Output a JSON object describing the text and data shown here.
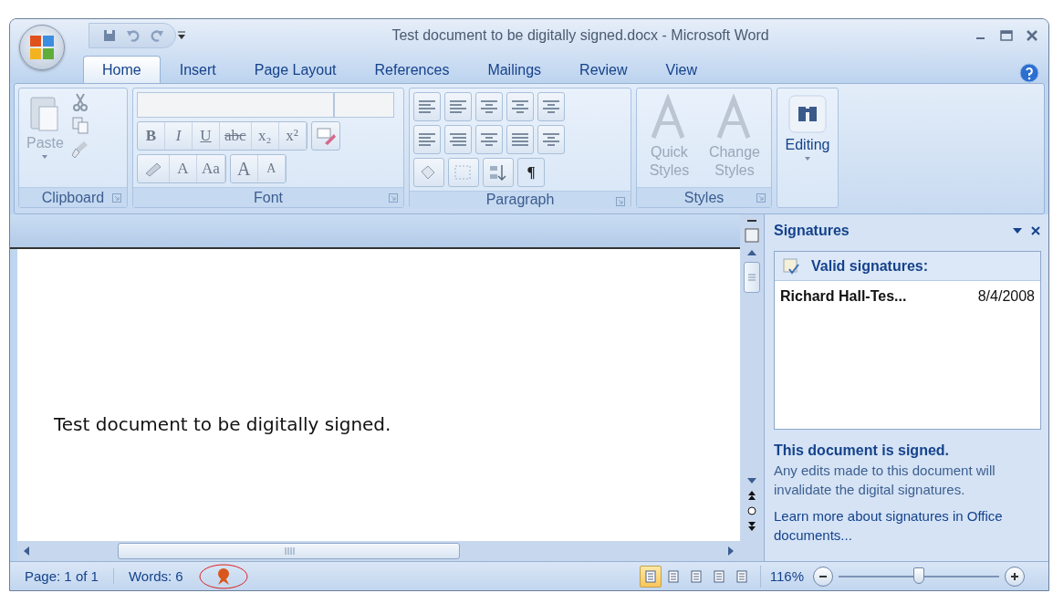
{
  "window": {
    "title": "Test document to be digitally signed.docx - Microsoft Word"
  },
  "tabs": [
    {
      "label": "Home",
      "selected": true
    },
    {
      "label": "Insert",
      "selected": false
    },
    {
      "label": "Page Layout",
      "selected": false
    },
    {
      "label": "References",
      "selected": false
    },
    {
      "label": "Mailings",
      "selected": false
    },
    {
      "label": "Review",
      "selected": false
    },
    {
      "label": "View",
      "selected": false
    }
  ],
  "ribbon": {
    "clipboard": {
      "title": "Clipboard",
      "paste": "Paste"
    },
    "font": {
      "title": "Font",
      "format_buttons": [
        "B",
        "I",
        "U",
        "abc",
        "x₂",
        "x²"
      ],
      "effect_buttons": [
        "A",
        "Aa",
        "A",
        "A"
      ]
    },
    "paragraph": {
      "title": "Paragraph",
      "pilcrow": "¶"
    },
    "styles": {
      "title": "Styles",
      "buttons": [
        {
          "label": "Quick Styles",
          "disabled": true
        },
        {
          "label": "Change Styles",
          "disabled": true
        }
      ]
    },
    "editing": {
      "label": "Editing"
    }
  },
  "document": {
    "text": "Test document to be digitally signed."
  },
  "signatures_pane": {
    "title": "Signatures",
    "list_header": "Valid signatures:",
    "signatures": [
      {
        "name": "Richard Hall-Tes...",
        "date": "8/4/2008"
      }
    ],
    "status_title": "This document is signed.",
    "status_text": "Any edits made to this document will invalidate the digital signatures.",
    "link": "Learn more about signatures in Office documents..."
  },
  "status_bar": {
    "page": "Page: 1 of 1",
    "words": "Words: 6",
    "views": [
      {
        "selected": true
      },
      {
        "selected": false
      },
      {
        "selected": false
      },
      {
        "selected": false
      },
      {
        "selected": false
      }
    ],
    "zoom": "116%",
    "zoom_slider": {
      "level": 0.5
    }
  }
}
